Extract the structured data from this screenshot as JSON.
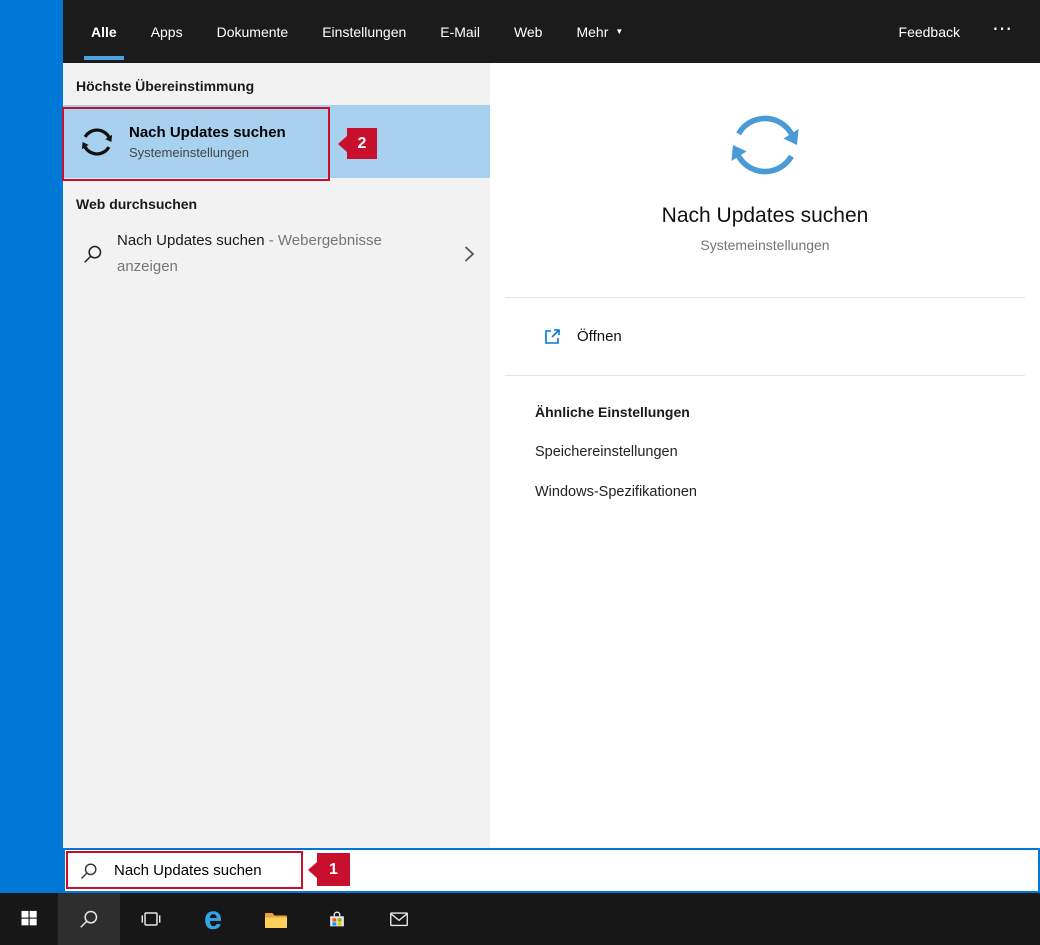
{
  "header": {
    "tabs": [
      "Alle",
      "Apps",
      "Dokumente",
      "Einstellungen",
      "E-Mail",
      "Web"
    ],
    "active_tab": "Alle",
    "more": "Mehr",
    "more_caret": "▼",
    "feedback": "Feedback",
    "ellipsis": "⋯"
  },
  "left": {
    "best_match_header": "Höchste Übereinstimmung",
    "best_match": {
      "title": "Nach Updates suchen",
      "subtitle": "Systemeinstellungen"
    },
    "web_header": "Web durchsuchen",
    "web_result": {
      "title": "Nach Updates suchen",
      "suffix": " - Webergebnisse anzeigen"
    }
  },
  "right": {
    "title": "Nach Updates suchen",
    "subtitle": "Systemeinstellungen",
    "open_label": "Öffnen",
    "related_header": "Ähnliche Einstellungen",
    "related": [
      "Speichereinstellungen",
      "Windows-Spezifikationen"
    ]
  },
  "search_bar": {
    "value": "Nach Updates suchen"
  },
  "annotations": {
    "badge1": "1",
    "badge2": "2",
    "color": "#c8102e"
  },
  "taskbar": {
    "buttons": [
      "start",
      "search",
      "task-view",
      "edge",
      "file-explorer",
      "store",
      "mail"
    ]
  },
  "colors": {
    "accent": "#0078d7",
    "header_bg": "#1b1b1b",
    "panel_bg": "#f2f2f2",
    "selection": "#a7d1ef",
    "update_icon_blue": "#4a9bd5",
    "taskbar_bg": "#171717"
  }
}
